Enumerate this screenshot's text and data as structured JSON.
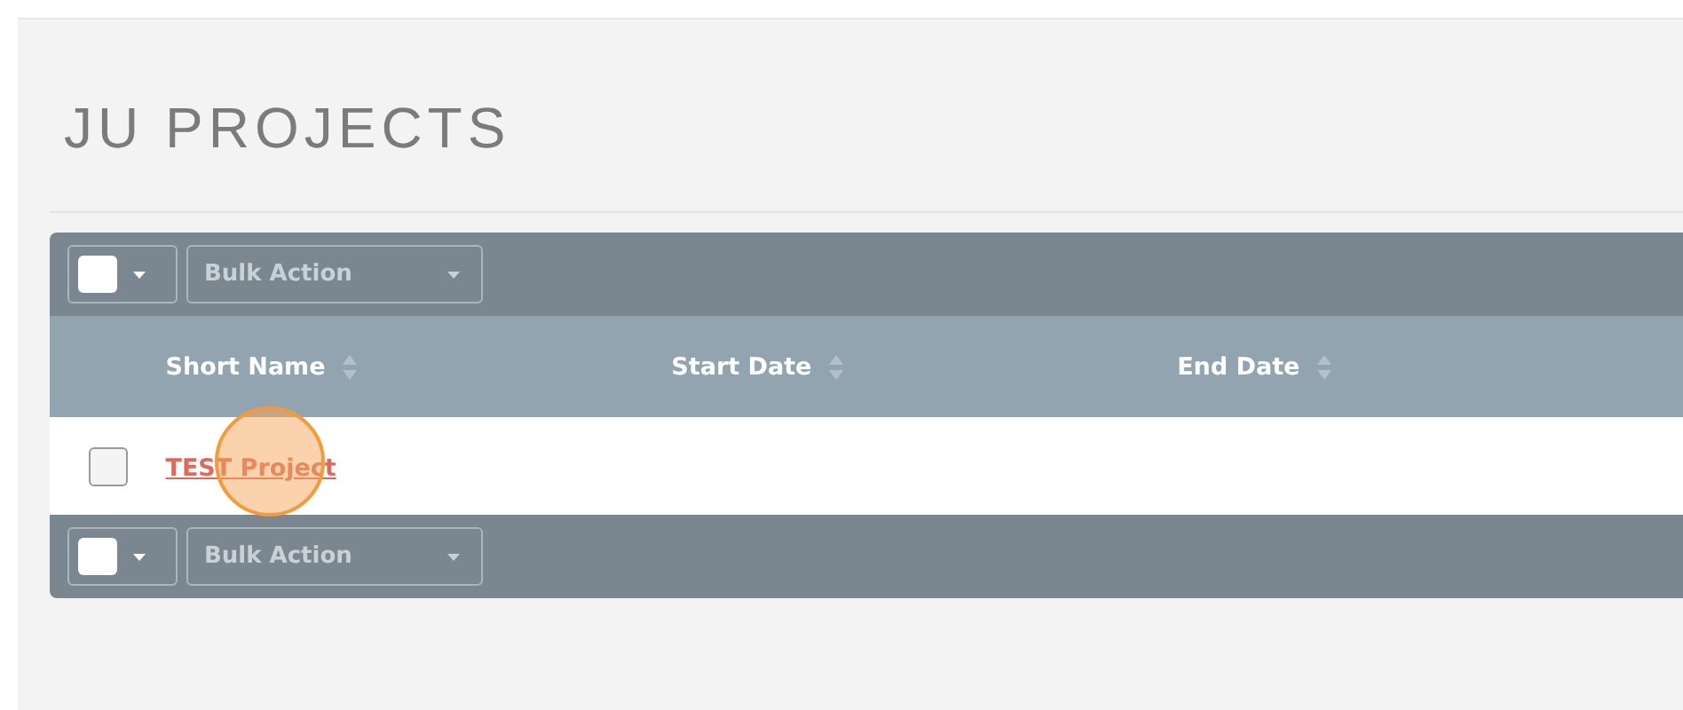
{
  "page_title": "JU PROJECTS",
  "top_toolbar": {
    "select_all_checked": false,
    "bulk_action": "Bulk Action"
  },
  "table": {
    "columns": [
      "Short Name",
      "Start Date",
      "End Date"
    ],
    "rows": [
      {
        "checked": false,
        "short_name": "TEST Project",
        "click_highlight": true
      }
    ]
  },
  "bottom_toolbar": {
    "select_all_checked": false,
    "bulk_action": "Bulk Action"
  }
}
